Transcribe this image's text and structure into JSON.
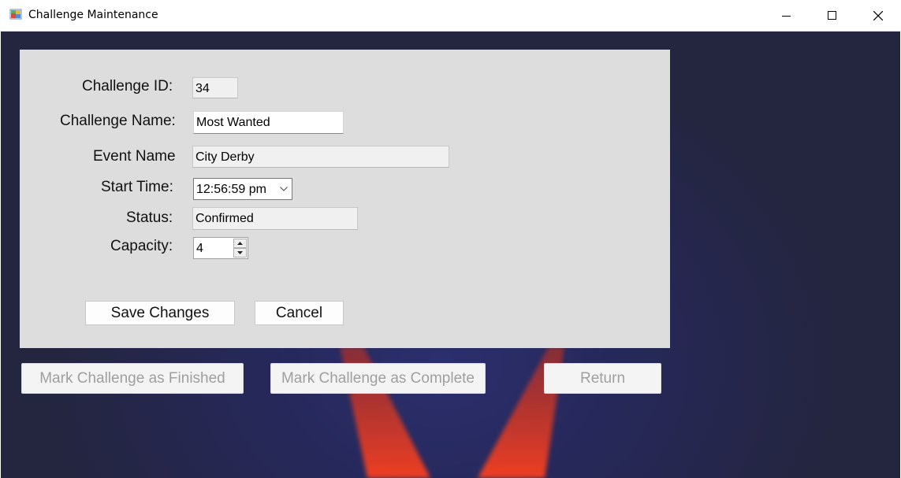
{
  "window": {
    "title": "Challenge Maintenance"
  },
  "form": {
    "challenge_id": {
      "label": "Challenge ID:",
      "value": "34"
    },
    "challenge_name": {
      "label": "Challenge Name:",
      "value": "Most Wanted"
    },
    "event_name": {
      "label": "Event Name",
      "value": "City Derby"
    },
    "start_time": {
      "label": "Start Time:",
      "value": "12:56:59 pm"
    },
    "status": {
      "label": "Status:",
      "value": "Confirmed"
    },
    "capacity": {
      "label": "Capacity:",
      "value": "4"
    }
  },
  "buttons": {
    "save": "Save Changes",
    "cancel": "Cancel",
    "mark_finished": "Mark Challenge as Finished",
    "mark_complete": "Mark Challenge as Complete",
    "return": "Return"
  },
  "colors": {
    "panel": "#dddddd",
    "background": "#25274f",
    "beam": "#e13a22"
  }
}
